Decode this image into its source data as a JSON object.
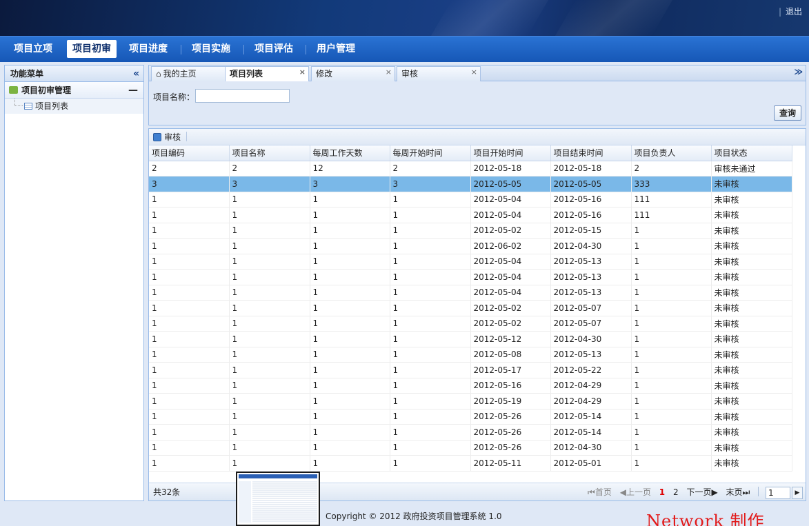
{
  "header": {
    "logout": "退出"
  },
  "nav": [
    "项目立项",
    "项目初审",
    "项目进度",
    "项目实施",
    "项目评估",
    "用户管理"
  ],
  "nav_active": "项目初审",
  "sidebar": {
    "title": "功能菜单",
    "collapse_icon": "«",
    "group": "项目初审管理",
    "group_toggle": "—",
    "item": "项目列表"
  },
  "tabs": [
    {
      "label": "我的主页",
      "icon": "home-icon"
    },
    {
      "label": "项目列表",
      "close": "×"
    },
    {
      "label": "修改",
      "close": "×"
    },
    {
      "label": "审核",
      "close": "×"
    }
  ],
  "tabs_menu_icon": "≫",
  "search": {
    "label": "项目名称：",
    "value": "",
    "button": "查询"
  },
  "toolbar": {
    "review": "审核"
  },
  "columns": [
    "项目编码",
    "项目名称",
    "每周工作天数",
    "每周开始时间",
    "项目开始时间",
    "项目结束时间",
    "项目负责人",
    "项目状态"
  ],
  "rows": [
    [
      "2",
      "2",
      "12",
      "2",
      "2012-05-18",
      "2012-05-18",
      "2",
      "审核未通过"
    ],
    [
      "3",
      "3",
      "3",
      "3",
      "2012-05-05",
      "2012-05-05",
      "333",
      "未审核"
    ],
    [
      "1",
      "1",
      "1",
      "1",
      "2012-05-04",
      "2012-05-16",
      "111",
      "未审核"
    ],
    [
      "1",
      "1",
      "1",
      "1",
      "2012-05-04",
      "2012-05-16",
      "111",
      "未审核"
    ],
    [
      "1",
      "1",
      "1",
      "1",
      "2012-05-02",
      "2012-05-15",
      "1",
      "未审核"
    ],
    [
      "1",
      "1",
      "1",
      "1",
      "2012-06-02",
      "2012-04-30",
      "1",
      "未审核"
    ],
    [
      "1",
      "1",
      "1",
      "1",
      "2012-05-04",
      "2012-05-13",
      "1",
      "未审核"
    ],
    [
      "1",
      "1",
      "1",
      "1",
      "2012-05-04",
      "2012-05-13",
      "1",
      "未审核"
    ],
    [
      "1",
      "1",
      "1",
      "1",
      "2012-05-04",
      "2012-05-13",
      "1",
      "未审核"
    ],
    [
      "1",
      "1",
      "1",
      "1",
      "2012-05-02",
      "2012-05-07",
      "1",
      "未审核"
    ],
    [
      "1",
      "1",
      "1",
      "1",
      "2012-05-02",
      "2012-05-07",
      "1",
      "未审核"
    ],
    [
      "1",
      "1",
      "1",
      "1",
      "2012-05-12",
      "2012-04-30",
      "1",
      "未审核"
    ],
    [
      "1",
      "1",
      "1",
      "1",
      "2012-05-08",
      "2012-05-13",
      "1",
      "未审核"
    ],
    [
      "1",
      "1",
      "1",
      "1",
      "2012-05-17",
      "2012-05-22",
      "1",
      "未审核"
    ],
    [
      "1",
      "1",
      "1",
      "1",
      "2012-05-16",
      "2012-04-29",
      "1",
      "未审核"
    ],
    [
      "1",
      "1",
      "1",
      "1",
      "2012-05-19",
      "2012-04-29",
      "1",
      "未审核"
    ],
    [
      "1",
      "1",
      "1",
      "1",
      "2012-05-26",
      "2012-05-14",
      "1",
      "未审核"
    ],
    [
      "1",
      "1",
      "1",
      "1",
      "2012-05-26",
      "2012-05-14",
      "1",
      "未审核"
    ],
    [
      "1",
      "1",
      "1",
      "1",
      "2012-05-26",
      "2012-04-30",
      "1",
      "未审核"
    ],
    [
      "1",
      "1",
      "1",
      "1",
      "2012-05-11",
      "2012-05-01",
      "1",
      "未审核"
    ]
  ],
  "selected_row": 1,
  "footer": {
    "total": "共32条",
    "first": "首页",
    "prev": "上一页",
    "page1": "1",
    "page2": "2",
    "next": "下一页",
    "last": "末页",
    "page_input": "1",
    "go": "▶"
  },
  "copyright": "Copyright © 2012 政府投资项目管理系统 1.0",
  "watermark": "Network 制作"
}
